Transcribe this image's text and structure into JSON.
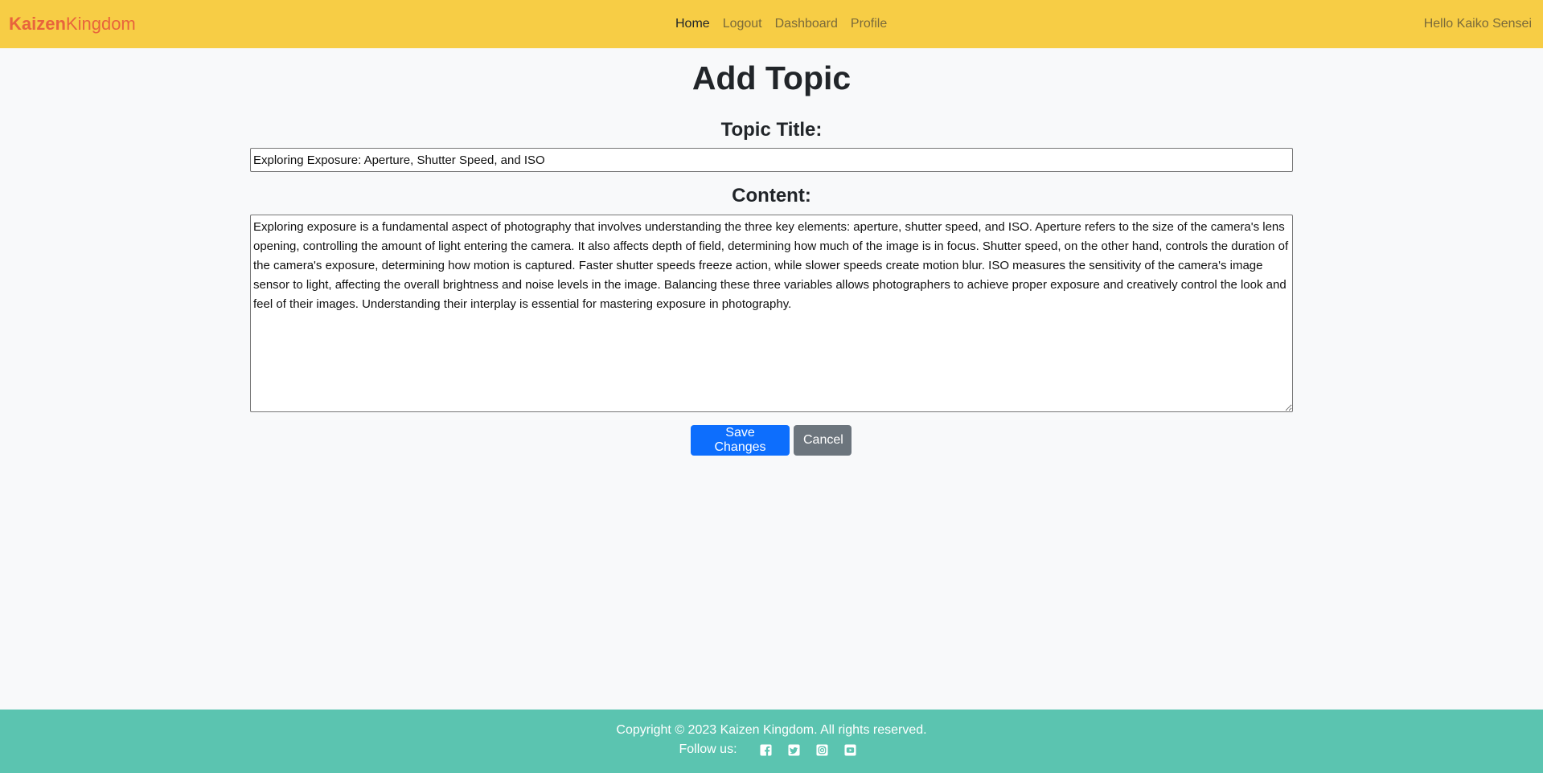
{
  "navbar": {
    "brand_part1": "Kaizen",
    "brand_part2": "Kingdom",
    "links": [
      {
        "label": "Home"
      },
      {
        "label": "Logout"
      },
      {
        "label": "Dashboard"
      },
      {
        "label": "Profile"
      }
    ],
    "greeting": "Hello Kaiko Sensei"
  },
  "main": {
    "page_title": "Add Topic",
    "topic_title_label": "Topic Title:",
    "topic_title_value": "Exploring Exposure: Aperture, Shutter Speed, and ISO",
    "content_label": "Content:",
    "content_value": "Exploring exposure is a fundamental aspect of photography that involves understanding the three key elements: aperture, shutter speed, and ISO. Aperture refers to the size of the camera's lens opening, controlling the amount of light entering the camera. It also affects depth of field, determining how much of the image is in focus. Shutter speed, on the other hand, controls the duration of the camera's exposure, determining how motion is captured. Faster shutter speeds freeze action, while slower speeds create motion blur. ISO measures the sensitivity of the camera's image sensor to light, affecting the overall brightness and noise levels in the image. Balancing these three variables allows photographers to achieve proper exposure and creatively control the look and feel of their images. Understanding their interplay is essential for mastering exposure in photography.",
    "save_label": "Save Changes",
    "cancel_label": "Cancel"
  },
  "footer": {
    "copyright": "Copyright © 2023 Kaizen Kingdom. All rights reserved.",
    "follow_label": "Follow us:",
    "social_icons": [
      "facebook-icon",
      "twitter-icon",
      "instagram-icon",
      "youtube-icon"
    ]
  },
  "colors": {
    "navbar_bg": "#f7cd45",
    "brand": "#e8643c",
    "footer_bg": "#5bc4b0",
    "primary_button": "#0d6efd",
    "secondary_button": "#6c757d"
  }
}
